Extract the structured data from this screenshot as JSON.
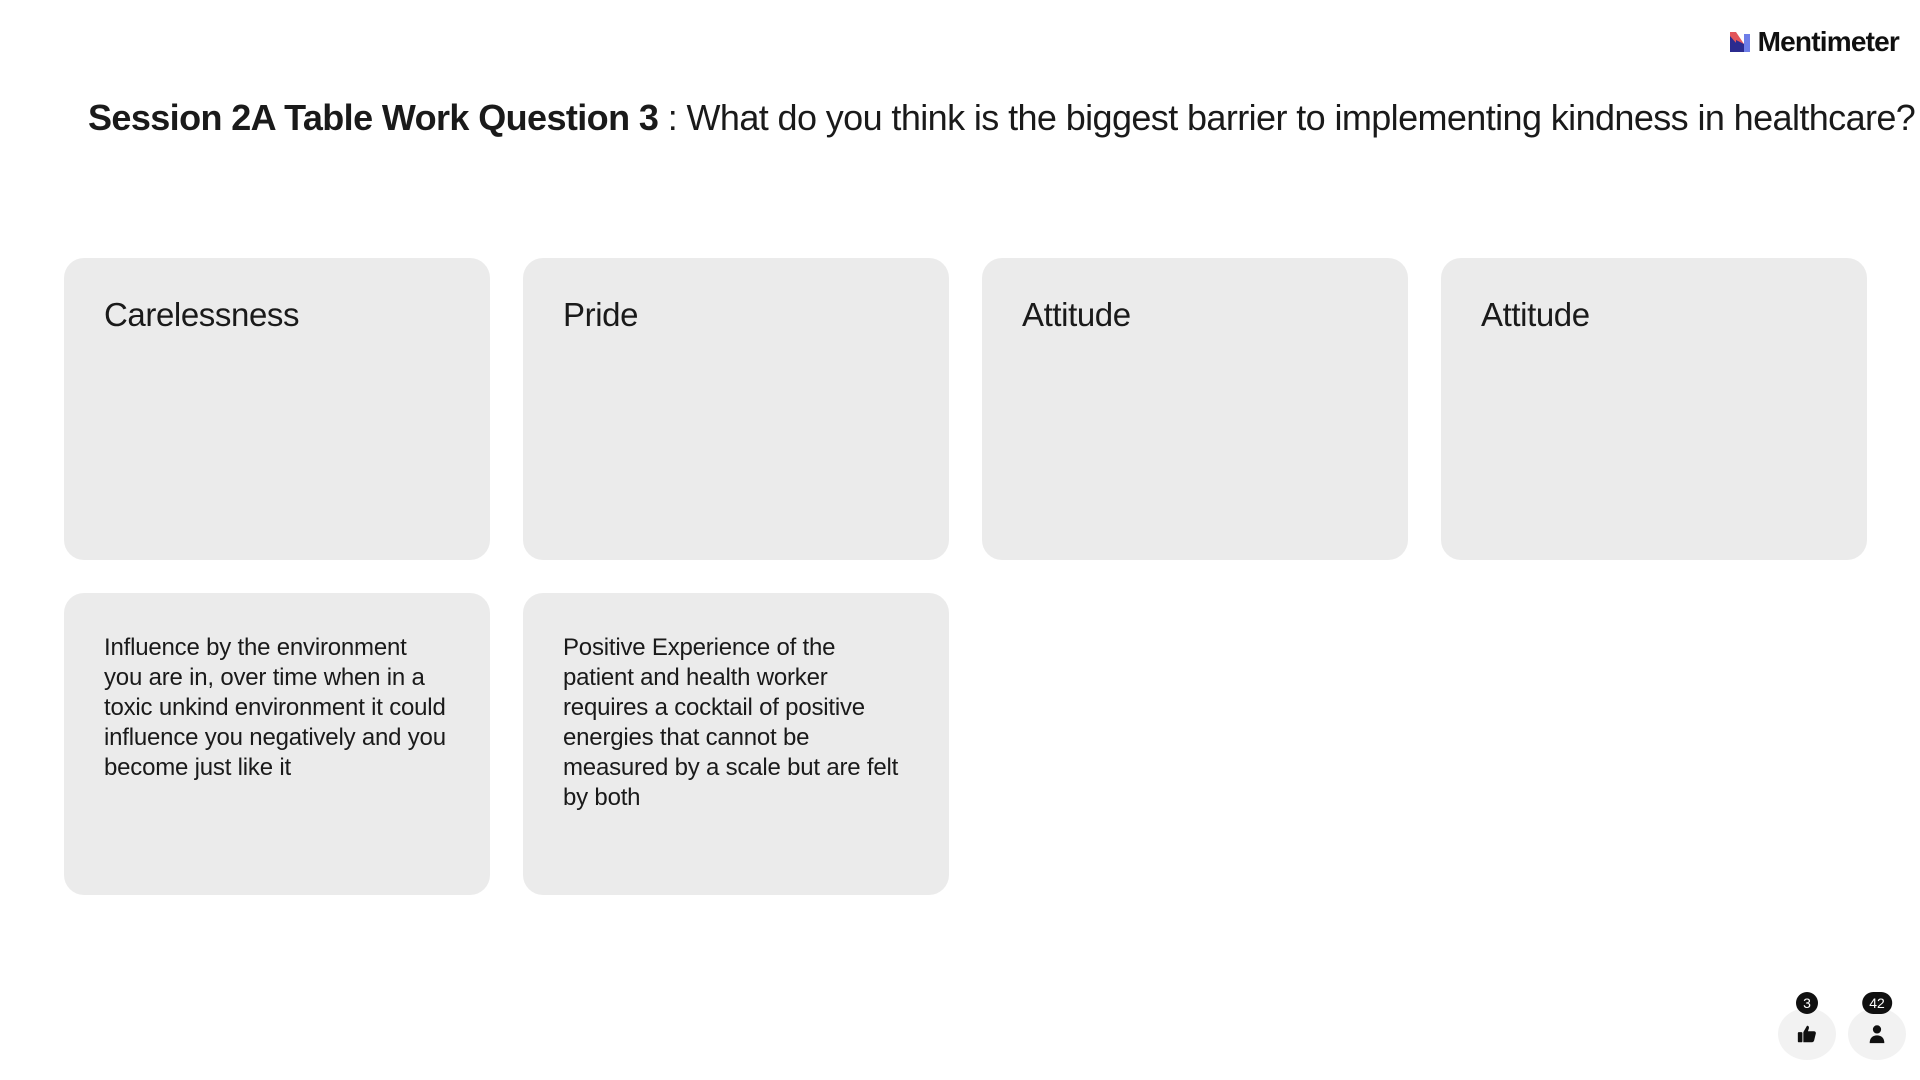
{
  "brand": {
    "name": "Mentimeter",
    "logo_icon": "mentimeter-logo-icon",
    "logo_colors": [
      "#2b2b8f",
      "#e2555b",
      "#6e7ee8"
    ]
  },
  "question": {
    "title": "Session 2A Table Work Question 3",
    "separator": " : ",
    "text": "What do you think is the biggest barrier to implementing kindness in healthcare?"
  },
  "responses": [
    {
      "text": "Carelessness"
    },
    {
      "text": "Pride"
    },
    {
      "text": "Attitude"
    },
    {
      "text": "Attitude"
    },
    {
      "text": "Influence by the environment you are in, over time when in a toxic unkind environment it could influence you negatively and you become just like it"
    },
    {
      "text": "Positive Experience of the patient and health worker requires a cocktail of positive energies that cannot be measured by a scale but are felt by both"
    }
  ],
  "stats": {
    "reactions": {
      "count": "3",
      "icon": "thumbs-up-icon"
    },
    "participants": {
      "count": "42",
      "icon": "person-icon"
    }
  },
  "colors": {
    "card_background": "#ebebeb",
    "text": "#1a1a1a",
    "badge_background": "#101010"
  }
}
